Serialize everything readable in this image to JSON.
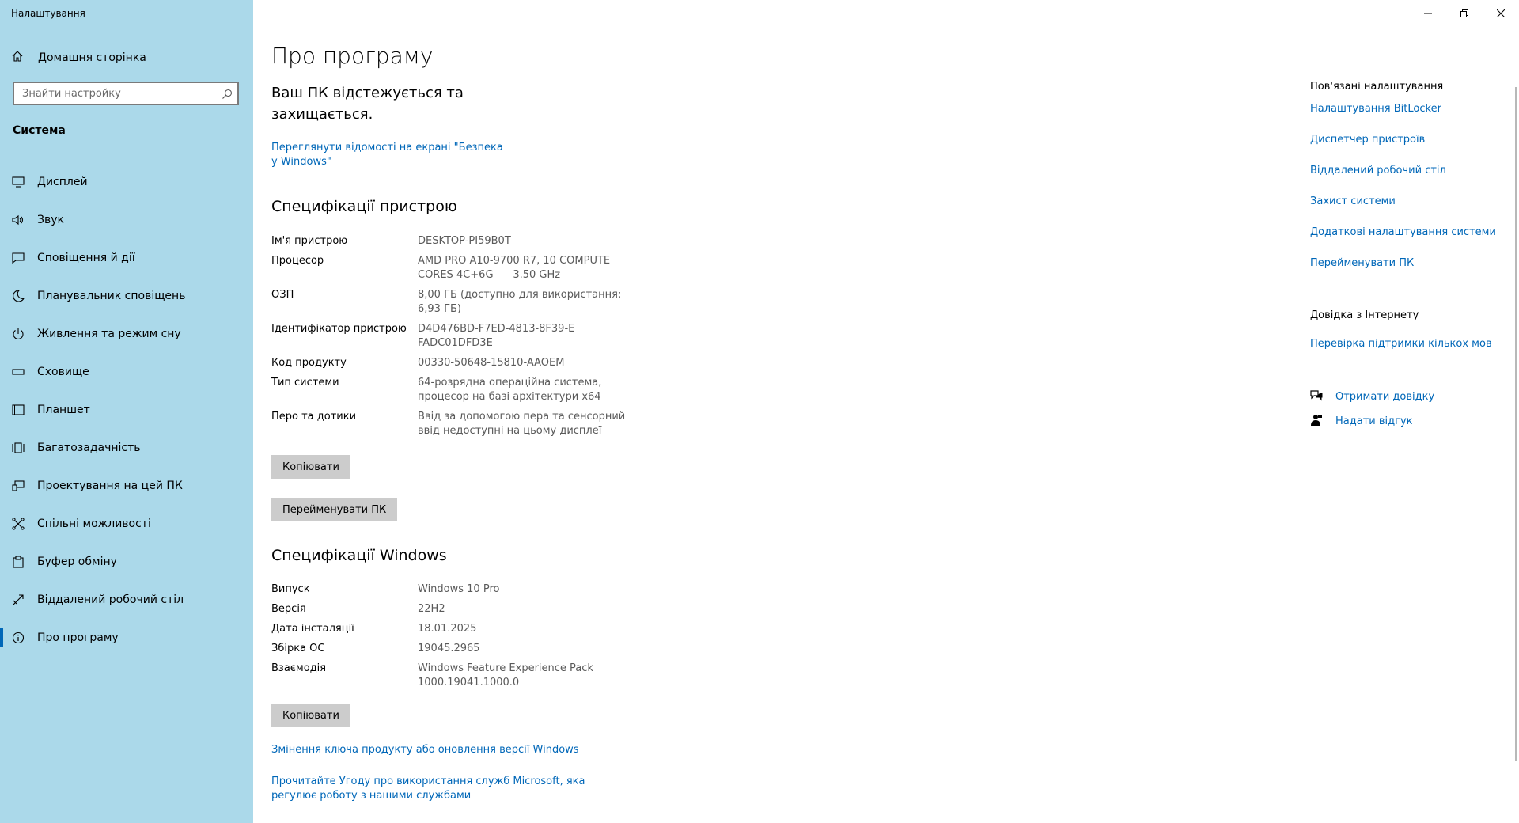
{
  "window": {
    "title": "Налаштування"
  },
  "sidebar": {
    "home_label": "Домашня сторінка",
    "search_placeholder": "Знайти настройку",
    "section_title": "Система",
    "items": [
      {
        "label": "Дисплей",
        "icon": "display-icon"
      },
      {
        "label": "Звук",
        "icon": "speaker-icon"
      },
      {
        "label": "Сповіщення й дії",
        "icon": "notification-icon"
      },
      {
        "label": "Планувальник сповіщень",
        "icon": "moon-icon"
      },
      {
        "label": "Живлення та режим сну",
        "icon": "power-icon"
      },
      {
        "label": "Сховище",
        "icon": "storage-icon"
      },
      {
        "label": "Планшет",
        "icon": "tablet-icon"
      },
      {
        "label": "Багатозадачність",
        "icon": "multitasking-icon"
      },
      {
        "label": "Проектування на цей ПК",
        "icon": "projecting-icon"
      },
      {
        "label": "Спільні можливості",
        "icon": "shared-experiences-icon"
      },
      {
        "label": "Буфер обміну",
        "icon": "clipboard-icon"
      },
      {
        "label": "Віддалений робочий стіл",
        "icon": "remote-desktop-icon"
      },
      {
        "label": "Про програму",
        "icon": "info-icon",
        "active": true
      }
    ]
  },
  "main": {
    "title": "Про програму",
    "protection_text": "Ваш ПК відстежується та захищається.",
    "security_link": "Переглянути відомості на екрані \"Безпека у Windows\"",
    "device_specs": {
      "heading": "Специфікації пристрою",
      "rows": [
        {
          "key": "Ім'я пристрою",
          "value": "DESKTOP-PI59B0T"
        },
        {
          "key": "Процесор",
          "value": "AMD PRO A10-9700 R7, 10 COMPUTE CORES 4C+6G      3.50 GHz"
        },
        {
          "key": "ОЗП",
          "value": "8,00 ГБ (доступно для використання: 6,93 ГБ)"
        },
        {
          "key": "Ідентифікатор пристрою",
          "value": "D4D476BD-F7ED-4813-8F39-EFADC01DFD3E"
        },
        {
          "key": "Код продукту",
          "value": "00330-50648-15810-AAOEM"
        },
        {
          "key": "Тип системи",
          "value": "64-розрядна операційна система, процесор на базі архітектури x64"
        },
        {
          "key": "Перо та дотики",
          "value": "Ввід за допомогою пера та сенсорний ввід недоступні на цьому дисплеї"
        }
      ],
      "copy_label": "Копіювати",
      "rename_label": "Перейменувати ПК"
    },
    "windows_specs": {
      "heading": "Специфікації Windows",
      "rows": [
        {
          "key": "Випуск",
          "value": "Windows 10 Pro"
        },
        {
          "key": "Версія",
          "value": "22H2"
        },
        {
          "key": "Дата інсталяції",
          "value": "18.01.2025"
        },
        {
          "key": "Збірка ОС",
          "value": "19045.2965"
        },
        {
          "key": "Взаємодія",
          "value": "Windows Feature Experience Pack 1000.19041.1000.0"
        }
      ],
      "copy_label": "Копіювати"
    },
    "links": {
      "change_key": "Змінення ключа продукту або оновлення версії Windows",
      "agreement": "Прочитайте Угоду про використання служб Microsoft, яка регулює роботу з нашими службами"
    }
  },
  "related": {
    "heading": "Пов'язані налаштування",
    "links": [
      "Налаштування BitLocker",
      "Диспетчер пристроїв",
      "Віддалений робочий стіл",
      "Захист системи",
      "Додаткові налаштування системи",
      "Перейменувати ПК"
    ],
    "web_help_heading": "Довідка з Інтернету",
    "web_help_link": "Перевірка підтримки кількох мов",
    "get_help": "Отримати довідку",
    "feedback": "Надати відгук"
  },
  "colors": {
    "sidebar_bg": "#abd9ea",
    "link": "#0067b8",
    "button_bg": "#cccccc",
    "value_text": "#5a5a5a"
  }
}
